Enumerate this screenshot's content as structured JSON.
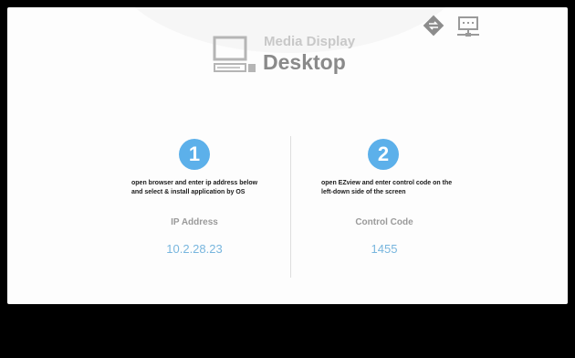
{
  "header": {
    "subtitle": "Media Display",
    "title": "Desktop",
    "icons": [
      "monitor-icon",
      "sync-icon",
      "network-icon"
    ]
  },
  "steps": [
    {
      "number": "1",
      "instruction": "open browser and enter ip address below and select & install application by OS",
      "label": "IP Address",
      "value": "10.2.28.23"
    },
    {
      "number": "2",
      "instruction": "open EZview and enter control code on the left-down side of the screen",
      "label": "Control Code",
      "value": "1455"
    }
  ],
  "colors": {
    "accent": "#5cb0ea",
    "value_text": "#78b6de",
    "label_text": "#9a9a9a",
    "title_text": "#8a8a8a",
    "background": "#fdfdfd",
    "frame": "#000000"
  }
}
